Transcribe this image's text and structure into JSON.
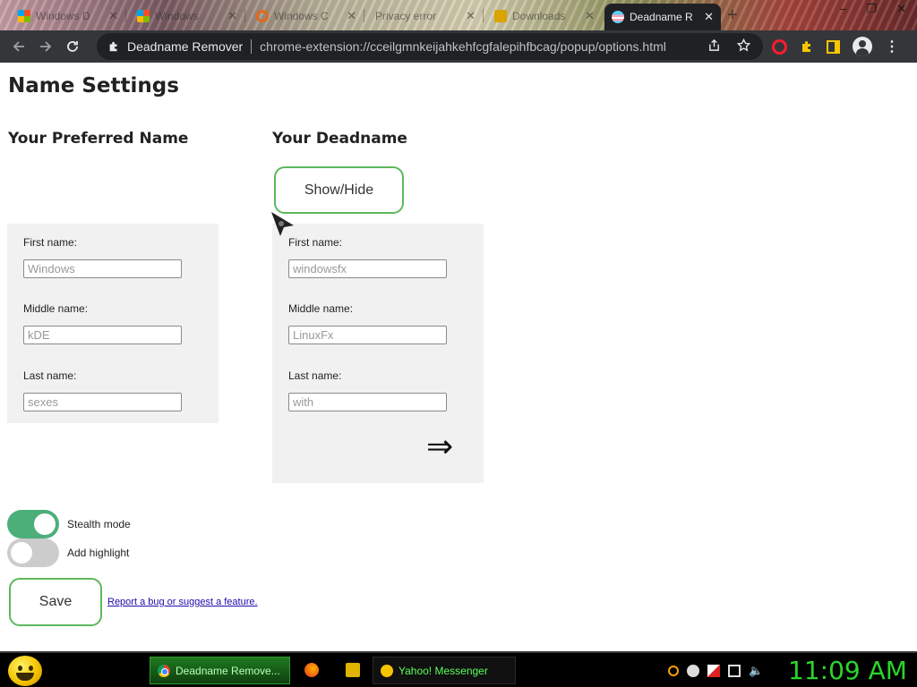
{
  "browser": {
    "tabs": [
      {
        "title": "Windows D",
        "icon": "windows-icon"
      },
      {
        "title": "Windows",
        "icon": "windows-icon"
      },
      {
        "title": "Windows C",
        "icon": "brave-icon"
      },
      {
        "title": "Privacy error",
        "icon": "globe-icon"
      },
      {
        "title": "Downloads",
        "icon": "download-icon"
      },
      {
        "title": "Deadname R",
        "icon": "trans-flag-icon",
        "active": true
      }
    ],
    "new_tab": "+",
    "window_controls": [
      "–",
      "❐",
      "✕"
    ],
    "site_name": "Deadname Remover",
    "url": "chrome-extension://cceilgmnkeijahkehfcgfalepihfbcag/popup/options.html"
  },
  "page": {
    "title": "Name Settings",
    "preferred": {
      "heading": "Your Preferred Name",
      "first_label": "First name:",
      "first_value": "Windows",
      "middle_label": "Middle name:",
      "middle_value": "kDE",
      "last_label": "Last name:",
      "last_value": "sexes"
    },
    "deadname": {
      "heading": "Your Deadname",
      "show_hide": "Show/Hide",
      "first_label": "First name:",
      "first_value": "windowsfx",
      "middle_label": "Middle name:",
      "middle_value": "LinuxFx",
      "last_label": "Last name:",
      "last_value": "with",
      "arrow": "⇒"
    },
    "toggles": [
      {
        "label": "Stealth mode",
        "on": true
      },
      {
        "label": "Add highlight",
        "on": false
      }
    ],
    "save_label": "Save",
    "report_link": "Report a bug or suggest a feature."
  },
  "taskbar": {
    "active_task": "Deadname Remove...",
    "yahoo_task": "Yahoo! Messenger",
    "clock": "11:09 AM"
  },
  "colors": {
    "accent_green": "#5cb85c",
    "toggle_on": "#4caf7a",
    "toggle_off": "#cccccc",
    "panel_bg": "#f1f1f1",
    "clock_green": "#2bd52b"
  }
}
